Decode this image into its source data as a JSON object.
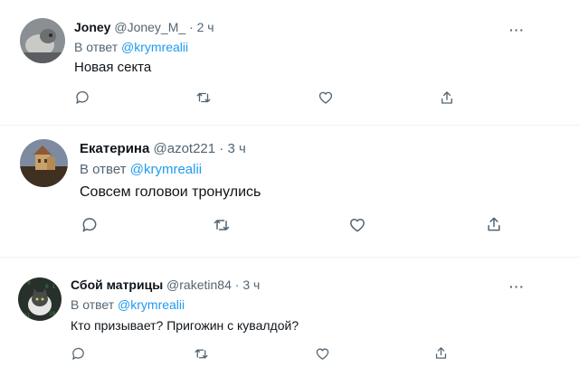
{
  "reply_prefix": "В ответ",
  "tweets": [
    {
      "name": "Joney",
      "handle": "@Joney_M_",
      "separator": "·",
      "time": "2 ч",
      "reply_to": "@krymrealii",
      "text": "Новая секта",
      "more": "···"
    },
    {
      "name": "Екатерина",
      "handle": "@azot221",
      "separator": "·",
      "time": "3 ч",
      "reply_to": "@krymrealii",
      "text": "Совсем головои тронулись"
    },
    {
      "name": "Сбой матрицы",
      "handle": "@raketin84",
      "separator": "·",
      "time": "3 ч",
      "reply_to": "@krymrealii",
      "text": "Кто призывает? Пригожин с кувалдой?",
      "more": "···"
    }
  ],
  "actions": [
    "reply-icon",
    "retweet-icon",
    "like-icon",
    "share-icon"
  ],
  "colors": {
    "text": "#0f1419",
    "secondary": "#536471",
    "link": "#1d9bf0",
    "divider": "#eff3f4"
  }
}
